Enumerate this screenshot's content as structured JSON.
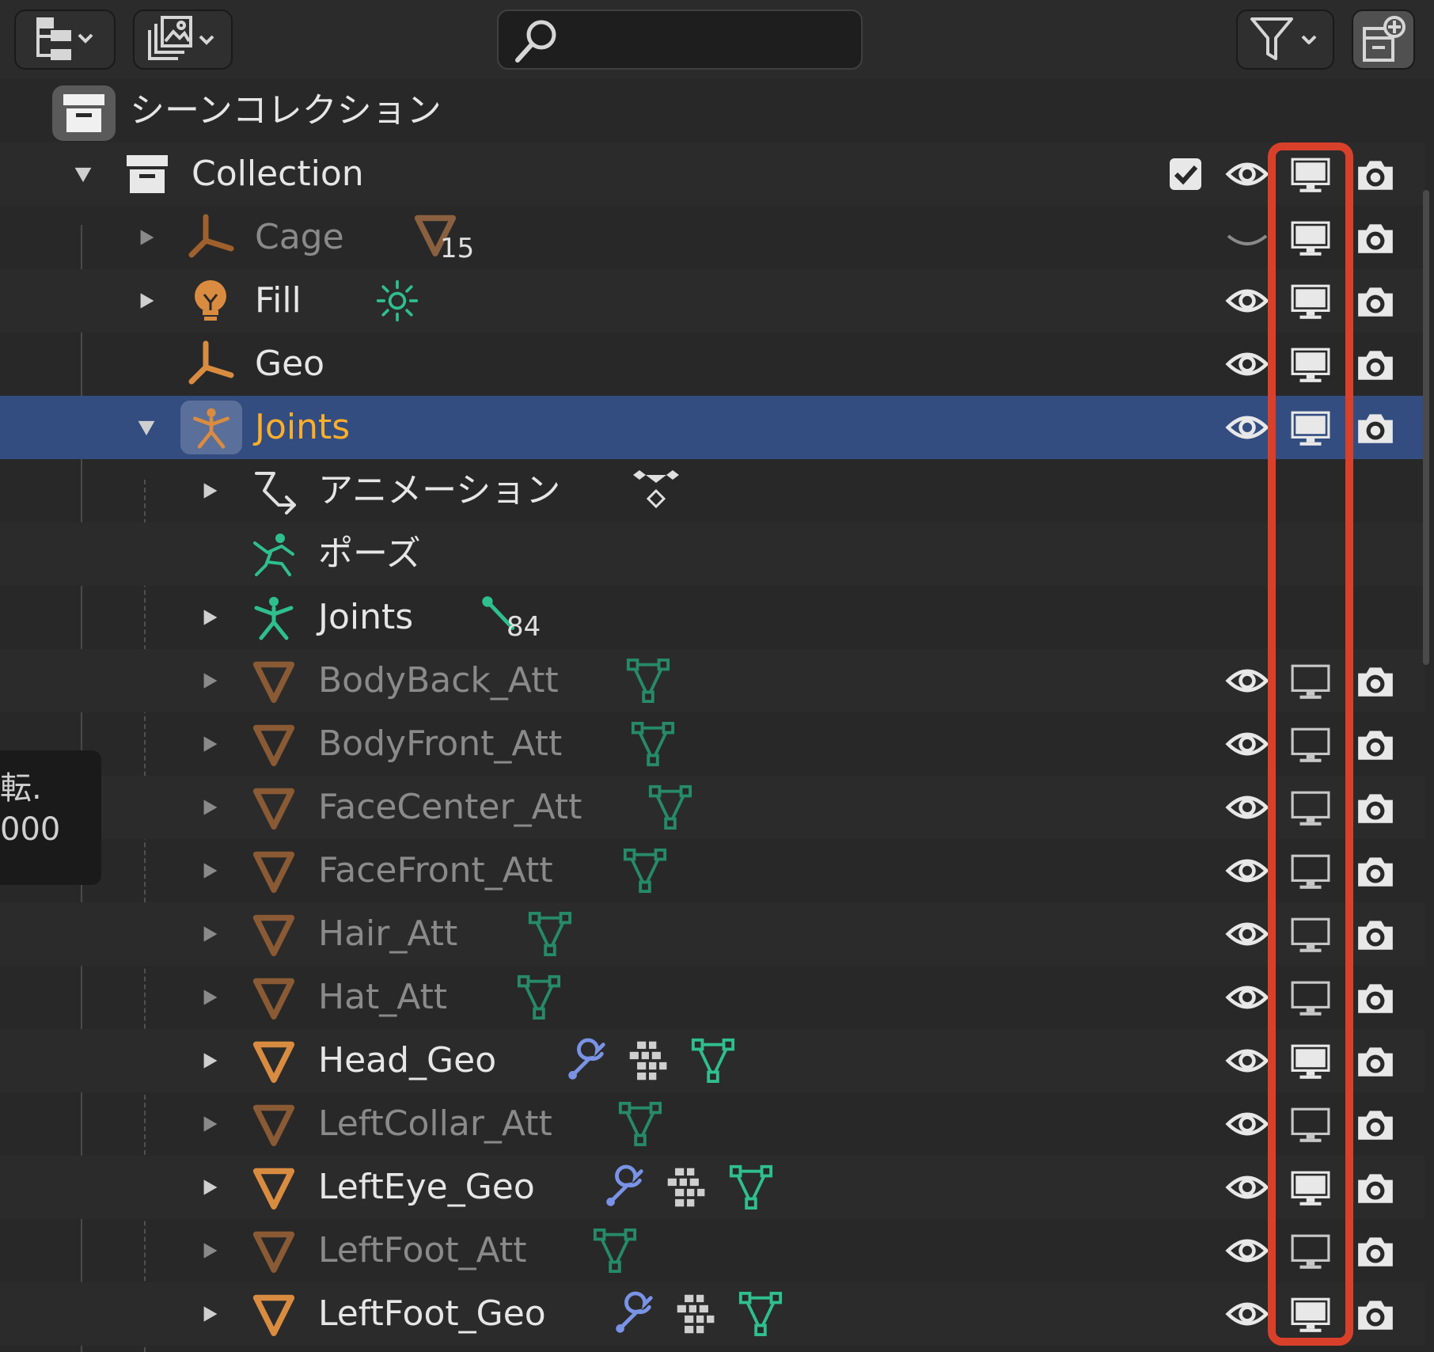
{
  "header": {
    "search_placeholder": ""
  },
  "scene_collection": {
    "label": "シーンコレクション"
  },
  "collection": {
    "label": "Collection"
  },
  "rows": {
    "cage": {
      "label": "Cage",
      "count": "15"
    },
    "fill": {
      "label": "Fill"
    },
    "geo": {
      "label": "Geo"
    },
    "joints": {
      "label": "Joints"
    },
    "animation": {
      "label": "アニメーション"
    },
    "pose": {
      "label": "ポーズ"
    },
    "joints_armature": {
      "label": "Joints",
      "count": "84"
    },
    "bodyback": {
      "label": "BodyBack_Att"
    },
    "bodyfront": {
      "label": "BodyFront_Att"
    },
    "facecenter": {
      "label": "FaceCenter_Att"
    },
    "facefront": {
      "label": "FaceFront_Att"
    },
    "hair": {
      "label": "Hair_Att"
    },
    "hat": {
      "label": "Hat_Att"
    },
    "head_geo": {
      "label": "Head_Geo"
    },
    "leftcollar": {
      "label": "LeftCollar_Att"
    },
    "lefteye_geo": {
      "label": "LeftEye_Geo"
    },
    "leftfoot_att": {
      "label": "LeftFoot_Att"
    },
    "leftfoot_geo": {
      "label": "LeftFoot_Geo"
    }
  },
  "tooltip": {
    "line1": "転.",
    "line2": "000"
  },
  "colors": {
    "background": "#282828",
    "selected_row": "#334d80",
    "selected_text": "#ffaf29",
    "object_icon": "#d98c40",
    "data_icon": "#2fbf8f",
    "modifier_icon": "#7a93e6",
    "highlight_frame": "#d9402a"
  },
  "icons": {
    "display_mode": "outliner-display-mode-icon",
    "view_layer": "view-layer-icon",
    "search": "search-icon",
    "filter": "filter-icon",
    "new_collection": "new-collection-icon",
    "visibility": "eye-icon",
    "viewport": "monitor-icon",
    "render": "camera-icon"
  }
}
